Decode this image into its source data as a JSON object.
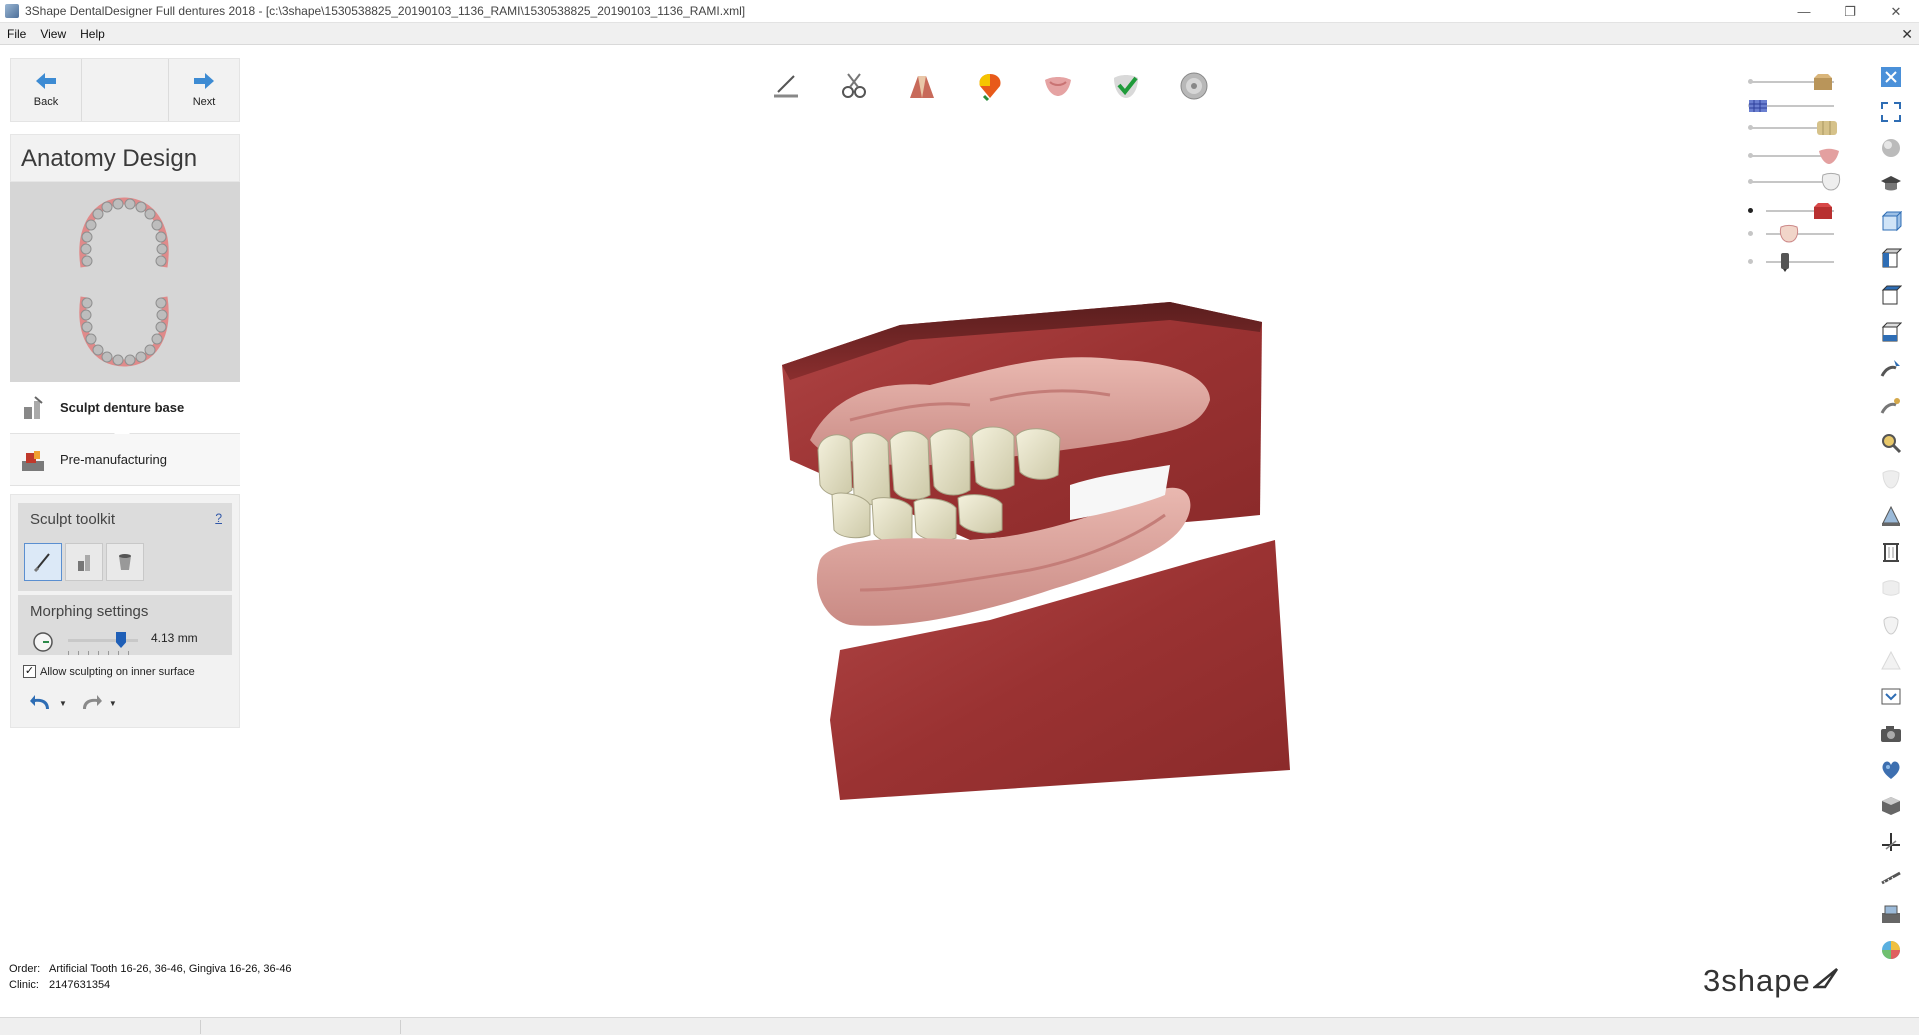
{
  "window": {
    "title": "3Shape DentalDesigner Full dentures 2018 - [c:\\3shape\\1530538825_20190103_1136_RAMI\\1530538825_20190103_1136_RAMI.xml]",
    "controls": [
      "minimize-icon",
      "restore-icon",
      "close-icon"
    ]
  },
  "menu": {
    "items": [
      "File",
      "View",
      "Help"
    ]
  },
  "nav": {
    "back": "Back",
    "next": "Next"
  },
  "step": {
    "title": "Anatomy Design"
  },
  "substeps": [
    {
      "label": "Sculpt denture base",
      "icon": "sculpt-base-icon",
      "active": true
    },
    {
      "label": "Pre-manufacturing",
      "icon": "pre-manufacturing-icon",
      "active": false
    }
  ],
  "toolkit": {
    "title": "Sculpt toolkit",
    "help": "?",
    "tools": [
      "knife-tool-icon",
      "wax-tool-icon",
      "cup-tool-icon"
    ],
    "morphing_title": "Morphing settings",
    "morphing_value": "4.13 mm",
    "checkbox_label": "Allow sculpting on inner surface",
    "checkbox_checked": true
  },
  "top_toolbar": [
    "set-tool-icon",
    "clip-tool-icon",
    "teeth-tool-icon",
    "color-tool-icon",
    "gingiva-tool-icon",
    "check-tool-icon",
    "disc-tool-icon"
  ],
  "visibility_sliders": [
    {
      "name": "upper-model-slider",
      "level": 0.8,
      "active": false
    },
    {
      "name": "upper-scan-slider",
      "level": 0.0,
      "active": false
    },
    {
      "name": "upper-teeth-slider",
      "level": 0.85,
      "active": false
    },
    {
      "name": "upper-gingiva-slider",
      "level": 0.9,
      "active": false
    },
    {
      "name": "lower-teeth-slider",
      "level": 0.95,
      "active": false
    },
    {
      "name": "lower-model-slider",
      "level": 0.8,
      "active": true
    },
    {
      "name": "lower-gingiva-slider",
      "level": 0.3,
      "active": false
    },
    {
      "name": "antagonist-slider",
      "level": 0.25,
      "active": false
    }
  ],
  "right_toolbar": [
    "close-view-icon",
    "fullscreen-icon",
    "sphere-icon",
    "graduation-cap-icon",
    "view-front-icon",
    "view-left-icon",
    "view-right-icon",
    "view-bottom-icon",
    "sculpt-pointer-icon",
    "sculpt-brush-icon",
    "magnifier-icon",
    "tooth-faded-icon",
    "cone-icon",
    "grid-tool-icon",
    "shape-faded-icon",
    "tooth-outline-icon",
    "warning-faded-icon",
    "screen-icon",
    "camera-icon",
    "heart-map-icon",
    "cube-icon",
    "axis-icon",
    "measure-icon",
    "scanner-icon",
    "color-wheel-icon"
  ],
  "order_info": {
    "order_label": "Order:",
    "order_value": "Artificial Tooth 16-26, 36-46, Gingiva 16-26, 36-46",
    "clinic_label": "Clinic:",
    "clinic_value": "2147631354"
  },
  "logo": {
    "text": "3shape"
  }
}
